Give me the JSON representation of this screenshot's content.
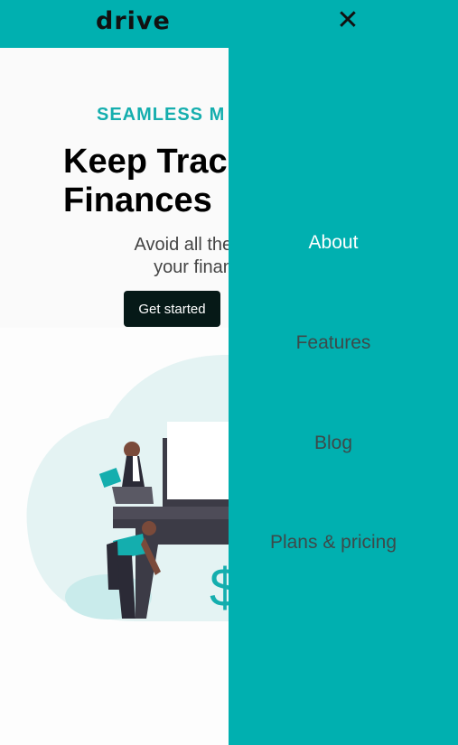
{
  "header": {
    "logo": "drive",
    "close_icon": "close-icon"
  },
  "hero": {
    "eyebrow": "SEAMLESS M",
    "headline_line1": "Keep Trac",
    "headline_line2": "Finances",
    "subtext_line1": "Avoid all the hasske tha",
    "subtext_line2": "your finanaces. Ge",
    "cta_label": "Get started"
  },
  "illustration": {
    "icon": "finance-illustration",
    "currency_glyph": "$"
  },
  "menu": {
    "items": [
      {
        "label": "About",
        "active": true
      },
      {
        "label": "Features",
        "active": false
      },
      {
        "label": "Blog",
        "active": false
      },
      {
        "label": "Plans & pricing",
        "active": false
      }
    ]
  },
  "colors": {
    "brand": "#00b0b0",
    "accent_text": "#15aeae",
    "button_bg": "#061917"
  }
}
